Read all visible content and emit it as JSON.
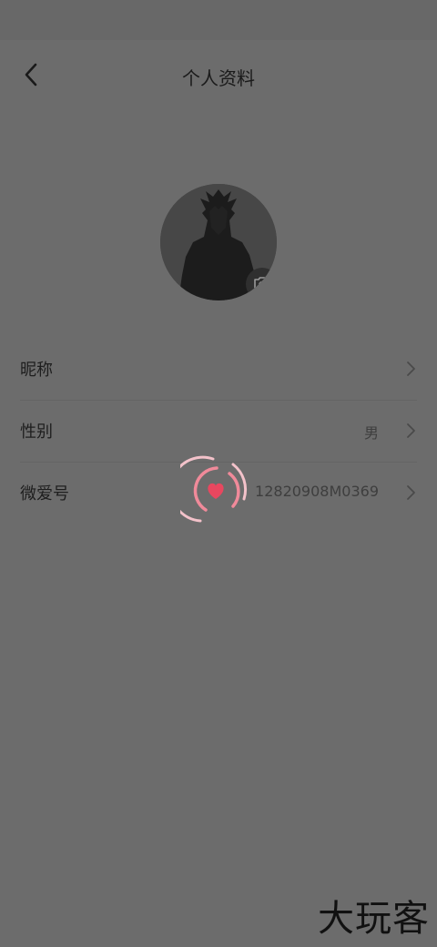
{
  "header": {
    "title": "个人资料"
  },
  "profile": {
    "avatar_icon": "avatar-silhouette",
    "camera_icon": "camera-add-icon"
  },
  "rows": [
    {
      "label": "昵称",
      "value": ""
    },
    {
      "label": "性别",
      "value": "男"
    },
    {
      "label": "微爱号",
      "value": "12820908M0369"
    }
  ],
  "colors": {
    "overlay": "#6c6c6c",
    "loader_pink": "#f08a9a",
    "loader_heart": "#e8475f"
  },
  "watermark": "大玩客"
}
